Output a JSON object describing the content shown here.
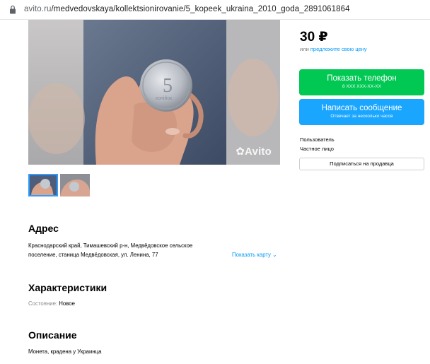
{
  "browser": {
    "url_host": "avito.ru",
    "url_path": "/medvedovskaya/kollektsionirovanie/5_kopeek_ukraina_2010_goda_2891061864"
  },
  "gallery": {
    "watermark": "Avito",
    "coin_text": "5",
    "coin_text_bottom": "копійок"
  },
  "sidebar": {
    "price": "30 ₽",
    "offer_prefix": "или ",
    "offer_link": "предложите свою цену",
    "phone_button": {
      "label": "Показать телефон",
      "sub": "8 XXX XXX-XX-XX",
      "color": "#00c853"
    },
    "message_button": {
      "label": "Написать сообщение",
      "sub": "Отвечает за несколько часов",
      "color": "#1aa5ff"
    },
    "seller_name": "Пользователь",
    "seller_type": "Частное лицо",
    "subscribe_label": "Подписаться на продавца"
  },
  "address": {
    "title": "Адрес",
    "line1": "Краснодарский край, Тимашевский р-н, Медвёдовское сельское",
    "line2": "поселение, станица Медвёдовская, ул. Ленина, 77",
    "map_link": "Показать карту"
  },
  "characteristics": {
    "title": "Характеристики",
    "condition_label": "Состояние:",
    "condition_value": "Новое"
  },
  "description": {
    "title": "Описание",
    "text": "Монета, крадена у Украинца"
  },
  "colors": {
    "accent_link": "#0099f7"
  }
}
